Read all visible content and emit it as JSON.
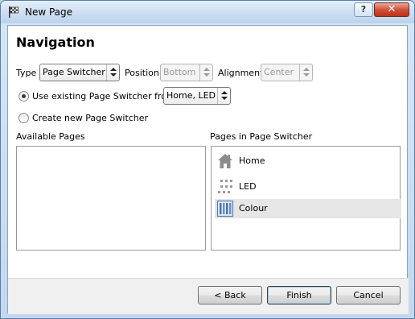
{
  "window": {
    "title": "New Page",
    "help_label": "?",
    "close_label": "✕"
  },
  "page": {
    "heading": "Navigation"
  },
  "options_row": {
    "type_label": "Type",
    "type_value": "Page Switcher",
    "position_label": "Position",
    "position_value": "Bottom",
    "alignment_label": "Alignment",
    "alignment_value": "Center"
  },
  "source_options": {
    "use_existing_label": "Use existing Page Switcher from",
    "use_existing_checked": true,
    "existing_value": "Home, LED",
    "create_new_label": "Create new Page Switcher",
    "create_new_checked": false
  },
  "available_pages": {
    "label": "Available Pages",
    "items": []
  },
  "switcher_pages": {
    "label": "Pages in Page Switcher",
    "items": [
      {
        "label": "Home",
        "icon": "home-icon",
        "selected": false
      },
      {
        "label": "LED",
        "icon": "led-dots-icon",
        "selected": false
      },
      {
        "label": "Colour",
        "icon": "colour-bars-icon",
        "selected": true
      }
    ]
  },
  "buttons": {
    "back": "< Back",
    "finish": "Finish",
    "cancel": "Cancel"
  },
  "colors": {
    "selection": "#e6e6e6",
    "title_gradient": "#cfe0f2",
    "close_red": "#c0301a"
  }
}
